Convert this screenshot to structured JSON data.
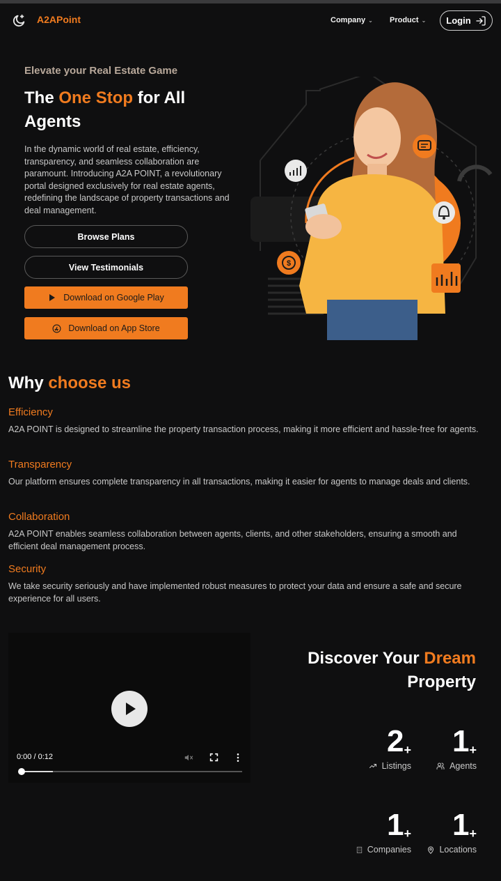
{
  "header": {
    "brand": "A2APoint",
    "nav": [
      {
        "label": "Company"
      },
      {
        "label": "Product"
      }
    ],
    "login_label": "Login"
  },
  "hero": {
    "eyebrow": "Elevate your Real Estate Game",
    "title_pre": "The ",
    "title_accent": "One Stop",
    "title_post": " for All Agents",
    "description": "In the dynamic world of real estate, efficiency, transparency, and seamless collaboration are paramount. Introducing A2A POINT, a revolutionary portal designed exclusively for real estate agents, redefining the landscape of property transactions and deal management.",
    "buttons": {
      "browse": "Browse Plans",
      "testimonials": "View Testimonials",
      "google_play": "Download on Google Play",
      "app_store": "Download on App Store"
    }
  },
  "why": {
    "title_pre": "Why ",
    "title_accent": "choose us",
    "features": [
      {
        "title": "Efficiency",
        "text": "A2A POINT is designed to streamline the property transaction process, making it more efficient and hassle-free for agents."
      },
      {
        "title": "Transparency",
        "text": "Our platform ensures complete transparency in all transactions, making it easier for agents to manage deals and clients."
      },
      {
        "title": "Collaboration",
        "text": "A2A POINT enables seamless collaboration between agents, clients, and other stakeholders, ensuring a smooth and efficient deal management process."
      },
      {
        "title": "Security",
        "text": "We take security seriously and have implemented robust measures to protect your data and ensure a safe and secure experience for all users."
      }
    ]
  },
  "video": {
    "time": "0:00 / 0:12",
    "buffered_fraction": 0.15
  },
  "discover": {
    "title_pre": "Discover Your ",
    "title_accent": "Dream",
    "title_post": "Property",
    "stats": [
      {
        "value": "2",
        "suffix": "+",
        "label": "Listings",
        "icon": "trending-up-icon"
      },
      {
        "value": "1",
        "suffix": "+",
        "label": "Agents",
        "icon": "users-icon"
      },
      {
        "value": "1",
        "suffix": "+",
        "label": "Companies",
        "icon": "building-icon"
      },
      {
        "value": "1",
        "suffix": "+",
        "label": "Locations",
        "icon": "map-pin-icon"
      }
    ]
  },
  "colors": {
    "accent": "#f07b1f",
    "background": "#0f0f10",
    "shirt": "#f6b542"
  }
}
